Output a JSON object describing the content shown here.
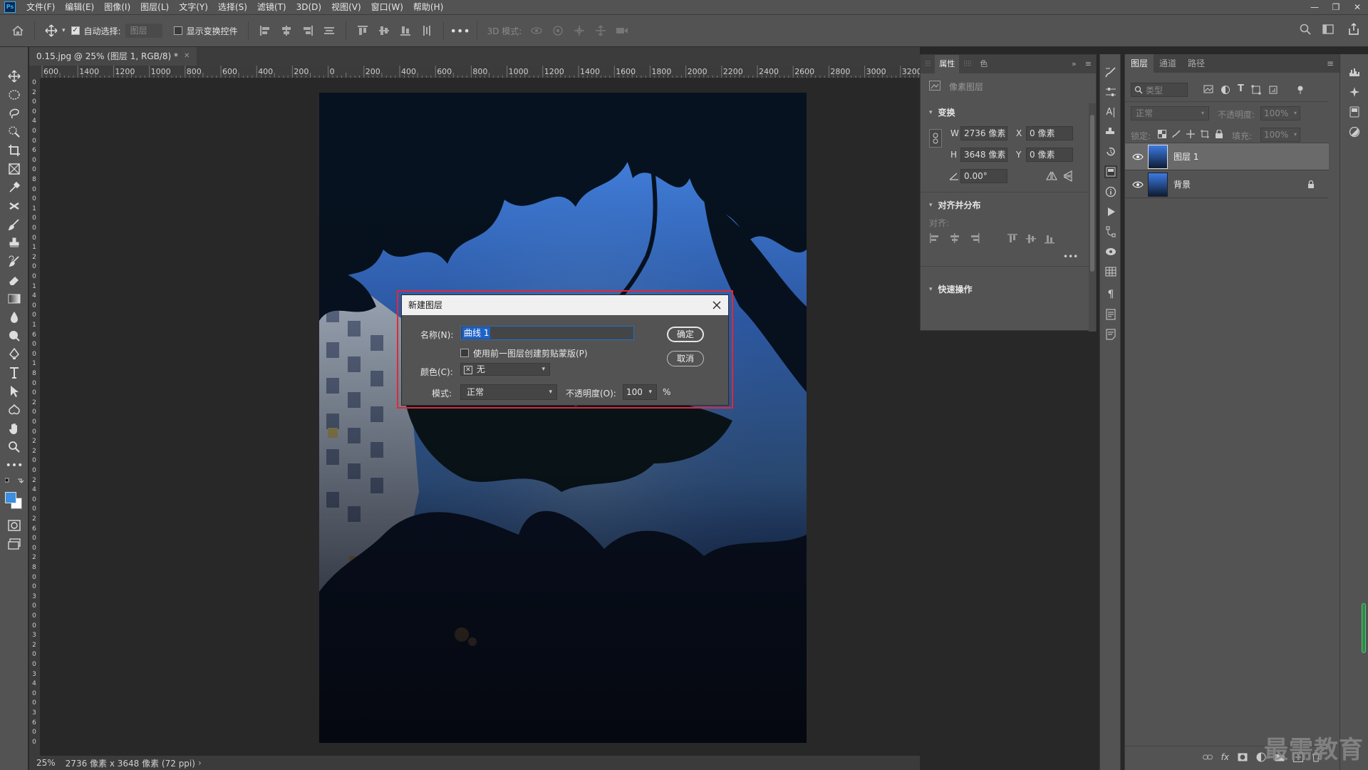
{
  "menubar": {
    "items": [
      "文件(F)",
      "编辑(E)",
      "图像(I)",
      "图层(L)",
      "文字(Y)",
      "选择(S)",
      "滤镜(T)",
      "3D(D)",
      "视图(V)",
      "窗口(W)",
      "帮助(H)"
    ],
    "logo": "Ps"
  },
  "options": {
    "auto_select_label": "自动选择:",
    "auto_select_target": "图层",
    "show_transform_label": "显示变换控件",
    "mode_3d_label": "3D 模式:"
  },
  "document": {
    "tab_title": "0.15.jpg @ 25% (图层 1, RGB/8) *"
  },
  "ruler": {
    "h_labels": [
      "600",
      "1400",
      "1200",
      "1000",
      "800",
      "600",
      "400",
      "200",
      "0",
      "200",
      "400",
      "600",
      "800",
      "1000",
      "1200",
      "1400",
      "1600",
      "1800",
      "2000",
      "2200",
      "2400",
      "2600",
      "2800",
      "3000",
      "3200"
    ],
    "v_labels": [
      "0",
      "2",
      "0",
      "0",
      "4",
      "0",
      "0",
      "6",
      "0",
      "0",
      "8",
      "0",
      "0",
      "1",
      "0",
      "0",
      "0",
      "1",
      "2",
      "0",
      "0",
      "1",
      "4",
      "0",
      "0",
      "1",
      "6",
      "0",
      "0",
      "1",
      "8",
      "0",
      "0",
      "2",
      "0",
      "0",
      "0",
      "2",
      "2",
      "0",
      "0",
      "2",
      "4",
      "0",
      "0",
      "2",
      "6",
      "0",
      "0",
      "2",
      "8",
      "0",
      "0",
      "3",
      "0",
      "0",
      "0",
      "3",
      "2",
      "0",
      "0",
      "3",
      "4",
      "0",
      "0",
      "3",
      "6",
      "0",
      "0"
    ]
  },
  "statusbar": {
    "zoom": "25%",
    "info": "2736 像素 x 3648 像素 (72 ppi)"
  },
  "properties": {
    "tabs": [
      "属性",
      "色"
    ],
    "layer_type": "像素图层",
    "transform_title": "变换",
    "w_label": "W",
    "w_value": "2736 像素",
    "x_label": "X",
    "x_value": "0 像素",
    "h_label": "H",
    "h_value": "3648 像素",
    "y_label": "Y",
    "y_value": "0 像素",
    "angle_value": "0.00°",
    "align_title": "对齐并分布",
    "align_label": "对齐:",
    "quick_title": "快速操作"
  },
  "layers": {
    "tabs": [
      "图层",
      "通道",
      "路径"
    ],
    "filter_placeholder": "类型",
    "blend_mode": "正常",
    "opacity_label": "不透明度:",
    "opacity_value": "100%",
    "lock_label": "锁定:",
    "fill_label": "填充:",
    "fill_value": "100%",
    "items": [
      {
        "name": "图层 1",
        "selected": true
      },
      {
        "name": "背景",
        "locked": true
      }
    ]
  },
  "dialog": {
    "title": "新建图层",
    "name_label": "名称(N):",
    "name_value": "曲线 1",
    "clip_label": "使用前一图层创建剪贴蒙版(P)",
    "color_label": "颜色(C):",
    "color_value": "无",
    "mode_label": "模式:",
    "mode_value": "正常",
    "opacity_label": "不透明度(O):",
    "opacity_value": "100",
    "percent": "%",
    "ok": "确定",
    "cancel": "取消"
  },
  "watermark": "最需教育",
  "colors": {
    "accent": "#31a8ff",
    "highlight": "#e0283a",
    "foreground_swatch": "#3a8fe0",
    "background_swatch": "#ffffff"
  }
}
